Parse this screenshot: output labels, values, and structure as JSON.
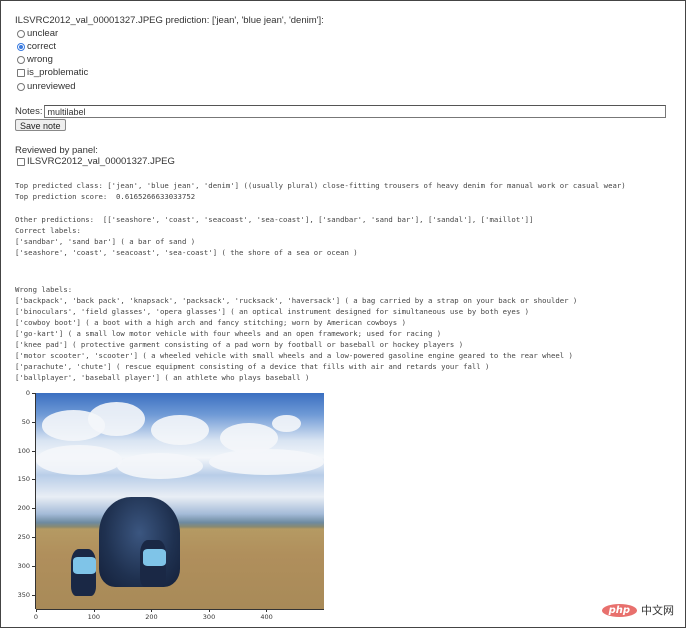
{
  "header": {
    "title": "ILSVRC2012_val_00001327.JPEG prediction: ['jean', 'blue jean', 'denim']:"
  },
  "review_options": [
    {
      "type": "radio",
      "label": "unclear",
      "checked": false
    },
    {
      "type": "radio",
      "label": "correct",
      "checked": true
    },
    {
      "type": "radio",
      "label": "wrong",
      "checked": false
    },
    {
      "type": "checkbox",
      "label": "is_problematic",
      "checked": false
    },
    {
      "type": "radio",
      "label": "unreviewed",
      "checked": false
    }
  ],
  "notes": {
    "label": "Notes:",
    "value": "multilabel",
    "save_label": "Save note"
  },
  "reviewed_by_panel": {
    "label": "Reviewed by panel:",
    "item_label": "ILSVRC2012_val_00001327.JPEG",
    "checked": false
  },
  "details": {
    "top_class": "Top predicted class: ['jean', 'blue jean', 'denim'] ((usually plural) close-fitting trousers of heavy denim for manual work or casual wear)",
    "top_score": "Top prediction score:  0.6165266633033752",
    "other_predictions": "Other predictions:  [['seashore', 'coast', 'seacoast', 'sea-coast'], ['sandbar', 'sand bar'], ['sandal'], ['maillot']]",
    "correct_labels_heading": "Correct labels:",
    "correct_labels": [
      "['sandbar', 'sand bar'] ( a bar of sand )",
      "['seashore', 'coast', 'seacoast', 'sea-coast'] ( the shore of a sea or ocean )"
    ],
    "wrong_labels_heading": "Wrong labels:",
    "wrong_labels": [
      "['backpack', 'back pack', 'knapsack', 'packsack', 'rucksack', 'haversack'] ( a bag carried by a strap on your back or shoulder )",
      "['binoculars', 'field glasses', 'opera glasses'] ( an optical instrument designed for simultaneous use by both eyes )",
      "['cowboy boot'] ( a boot with a high arch and fancy stitching; worn by American cowboys )",
      "['go-kart'] ( a small low motor vehicle with four wheels and an open framework; used for racing )",
      "['knee pad'] ( protective garment consisting of a pad worn by football or baseball or hockey players )",
      "['motor scooter', 'scooter'] ( a wheeled vehicle with small wheels and a low-powered gasoline engine geared to the rear wheel )",
      "['parachute', 'chute'] ( rescue equipment consisting of a device that fills with air and retards your fall )",
      "['ballplayer', 'baseball player'] ( an athlete who plays baseball )"
    ]
  },
  "image_plot": {
    "description": "beach scene with denim jeans on sand under cloudy blue sky",
    "x_ticks": [
      "0",
      "100",
      "200",
      "300",
      "400"
    ],
    "y_ticks": [
      "0",
      "50",
      "100",
      "150",
      "200",
      "250",
      "300",
      "350"
    ],
    "x_range": [
      0,
      500
    ],
    "y_range": [
      0,
      375
    ]
  },
  "watermark": {
    "badge": "php",
    "text": "中文网"
  }
}
